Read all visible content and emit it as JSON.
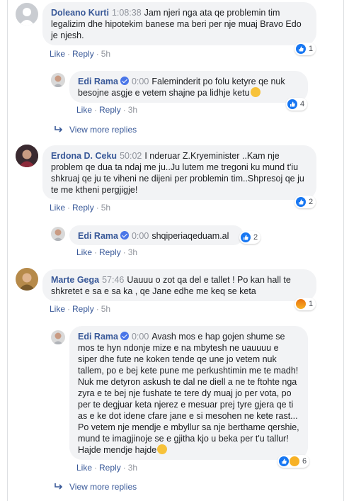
{
  "comments": [
    {
      "author": "Doleano Kurti",
      "timestamp": "1:08:38",
      "text": "Jam njeri nga ata qe problemin tim legalizim dhe hipotekim banese ma beri per nje muaj Bravo Edo je njesh.",
      "like": "Like",
      "reply": "Reply",
      "time": "5h",
      "reaction_count": "1"
    },
    {
      "author": "Edi Rama",
      "timestamp": "0:00",
      "text": "Faleminderit po folu ketyre qe nuk besojne asgje e vetem shajne pa lidhje ketu",
      "like": "Like",
      "reply": "Reply",
      "time": "3h",
      "reaction_count": "4"
    },
    {
      "author": "Erdona D. Ceku",
      "timestamp": "50:02",
      "text": "I nderuar Z.Kryeminister ..Kam nje problem qe dua ta ndaj me ju..Ju lutem me tregoni ku mund t'iu shkruaj qe ju te viheni ne dijeni per problemin tim..Shpresoj qe ju te me ktheni pergjigje!",
      "like": "Like",
      "reply": "Reply",
      "time": "5h",
      "reaction_count": "2"
    },
    {
      "author": "Edi Rama",
      "timestamp": "0:00",
      "text": "shqiperiaqeduam.al",
      "like": "Like",
      "reply": "Reply",
      "time": "3h",
      "reaction_count": "2"
    },
    {
      "author": "Marte Gega",
      "timestamp": "57:46",
      "text": "Uauuu o zot qa del e tallet ! Po kan hall te shkretet e sa e sa ka , qe Jane edhe me keq se keta",
      "like": "Like",
      "reply": "Reply",
      "time": "5h",
      "reaction_count": "1"
    },
    {
      "author": "Edi Rama",
      "timestamp": "0:00",
      "text": "Avash mos e hap gojen shume se mos te hyn ndonje mize e na mbytesh ne uauuuu e siper dhe fute ne koken tende qe une jo vetem nuk tallem, po e bej kete pune me perkushtimin me te madh! Nuk me detyron askush te dal ne diell a ne te ftohte nga zyra e te bej nje fushate te tere dy muaj jo per vota, po per te degjuar keta njerez e mesuar prej tyre gjera qe ti as e ke dot idene cfare jane e si mesohen ne kete rast... Po vetem nje mendje e mbyllur sa nje berthame qershie, mund te imagjinoje se e gjitha kjo u beka per t'u tallur! Hajde mendje hajde",
      "like": "Like",
      "reply": "Reply",
      "time": "3h",
      "reaction_count": "6"
    }
  ],
  "view_more_1": "View more replies",
  "view_more_2": "View more replies",
  "colors": {
    "link": "#385898",
    "bubble": "#f2f3f5",
    "like_blue": "#1877f2"
  }
}
